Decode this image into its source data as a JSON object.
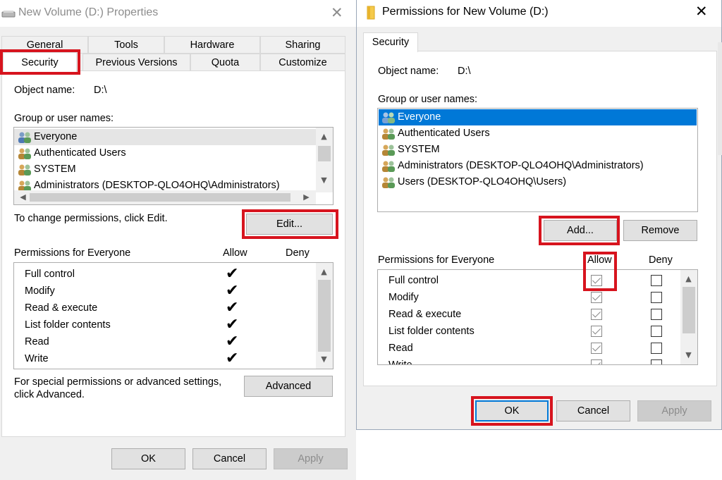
{
  "left_window": {
    "title": "New Volume (D:) Properties",
    "tabs_row1": [
      "General",
      "Tools",
      "Hardware",
      "Sharing"
    ],
    "tabs_row2": [
      "Security",
      "Previous Versions",
      "Quota",
      "Customize"
    ],
    "object_label": "Object name:",
    "object_value": "D:\\",
    "group_label": "Group or user names:",
    "users": [
      "Everyone",
      "Authenticated Users",
      "SYSTEM",
      "Administrators (DESKTOP-QLO4OHQ\\Administrators)"
    ],
    "change_text": "To change permissions, click Edit.",
    "edit_button": "Edit...",
    "permissions_label": "Permissions for Everyone",
    "allow_header": "Allow",
    "deny_header": "Deny",
    "permissions": [
      "Full control",
      "Modify",
      "Read & execute",
      "List folder contents",
      "Read",
      "Write"
    ],
    "allow_marks": [
      "✔",
      "✔",
      "✔",
      "✔",
      "✔",
      "✔"
    ],
    "special_text_line1": "For special permissions or advanced settings,",
    "special_text_line2": "click Advanced.",
    "advanced_button": "Advanced",
    "ok_button": "OK",
    "cancel_button": "Cancel",
    "apply_button": "Apply"
  },
  "right_window": {
    "title": "Permissions for New Volume (D:)",
    "tab": "Security",
    "object_label": "Object name:",
    "object_value": "D:\\",
    "group_label": "Group or user names:",
    "users": [
      "Everyone",
      "Authenticated Users",
      "SYSTEM",
      "Administrators (DESKTOP-QLO4OHQ\\Administrators)",
      "Users (DESKTOP-QLO4OHQ\\Users)"
    ],
    "add_button": "Add...",
    "remove_button": "Remove",
    "permissions_label": "Permissions for Everyone",
    "allow_header": "Allow",
    "deny_header": "Deny",
    "permissions": [
      "Full control",
      "Modify",
      "Read & execute",
      "List folder contents",
      "Read",
      "Write"
    ],
    "allow_checked": [
      true,
      true,
      true,
      true,
      true,
      true
    ],
    "deny_checked": [
      false,
      false,
      false,
      false,
      false,
      false
    ],
    "ok_button": "OK",
    "cancel_button": "Cancel",
    "apply_button": "Apply"
  },
  "colors": {
    "highlight": "#d7141e",
    "selection": "#0078d7",
    "window_bg": "#f0f0f0"
  }
}
